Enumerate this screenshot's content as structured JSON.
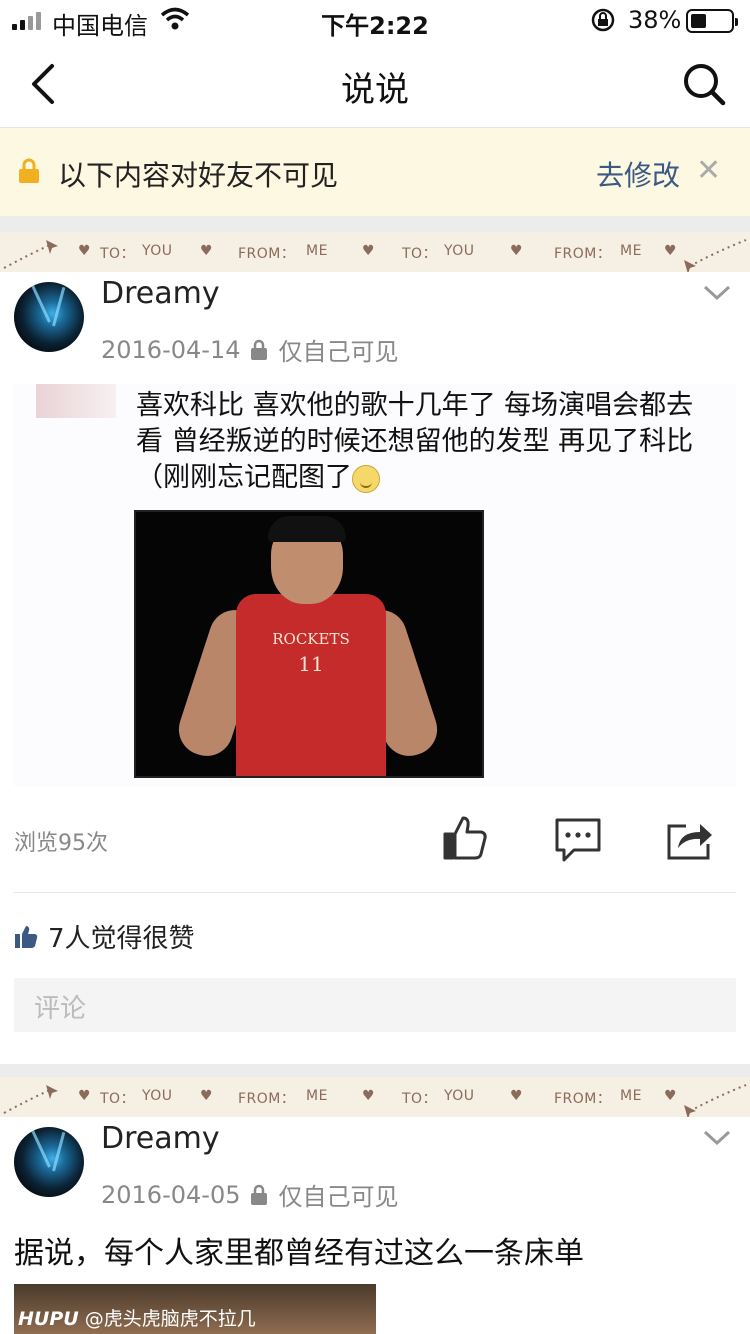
{
  "status_bar": {
    "carrier": "中国电信",
    "time": "下午2:22",
    "battery": "38%"
  },
  "nav": {
    "title": "说说"
  },
  "notice": {
    "text": "以下内容对好友不可见",
    "link": "去修改",
    "close": "✕"
  },
  "band": {
    "to": "TO：",
    "you": "YOU",
    "from": "FROM：",
    "me": "ME"
  },
  "posts": [
    {
      "author": "Dreamy",
      "date": "2016-04-14",
      "visibility": "仅自己可见",
      "image_text": "喜欢科比 喜欢他的歌十几年了 每场演唱会都去看 曾经叛逆的时候还想留他的发型 再见了科比 （刚刚忘记配图了",
      "jersey_team": "ROCKETS",
      "jersey_number": "11",
      "views": "浏览95次",
      "likes": "7人觉得很赞",
      "comment_placeholder": "评论"
    },
    {
      "author": "Dreamy",
      "date": "2016-04-05",
      "visibility": "仅自己可见",
      "text": "据说，每个人家里都曾经有过这么一条床单",
      "watermark_brand": "HUPU",
      "watermark_user": "@虎头虎脑虎不拉几"
    }
  ]
}
